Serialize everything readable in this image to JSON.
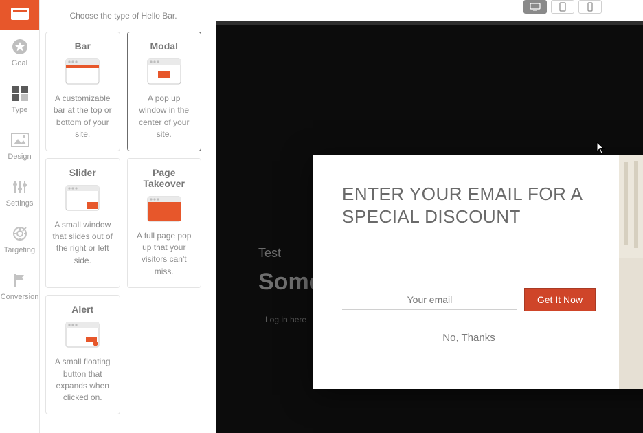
{
  "rail": {
    "items": [
      {
        "label": ""
      },
      {
        "label": "Goal"
      },
      {
        "label": "Type"
      },
      {
        "label": "Design"
      },
      {
        "label": "Settings"
      },
      {
        "label": "Targeting"
      },
      {
        "label": "Conversion"
      }
    ]
  },
  "panel": {
    "subtitle": "Choose the type of Hello Bar.",
    "types": [
      {
        "title": "Bar",
        "desc": "A customizable bar at the top or bottom of your site."
      },
      {
        "title": "Modal",
        "desc": "A pop up window in the center of your site."
      },
      {
        "title": "Slider",
        "desc": "A small window that slides out of the right or left side."
      },
      {
        "title": "Page Takeover",
        "desc": "A full page pop up that your visitors can't miss."
      },
      {
        "title": "Alert",
        "desc": "A small floating button that expands when clicked on."
      }
    ]
  },
  "preview": {
    "bg_title": "Test",
    "bg_heading": "Some",
    "bg_login": "Log in here",
    "modal": {
      "headline": "ENTER YOUR EMAIL FOR A SPECIAL DISCOUNT",
      "email_placeholder": "Your email",
      "cta": "Get It Now",
      "decline": "No, Thanks"
    }
  }
}
